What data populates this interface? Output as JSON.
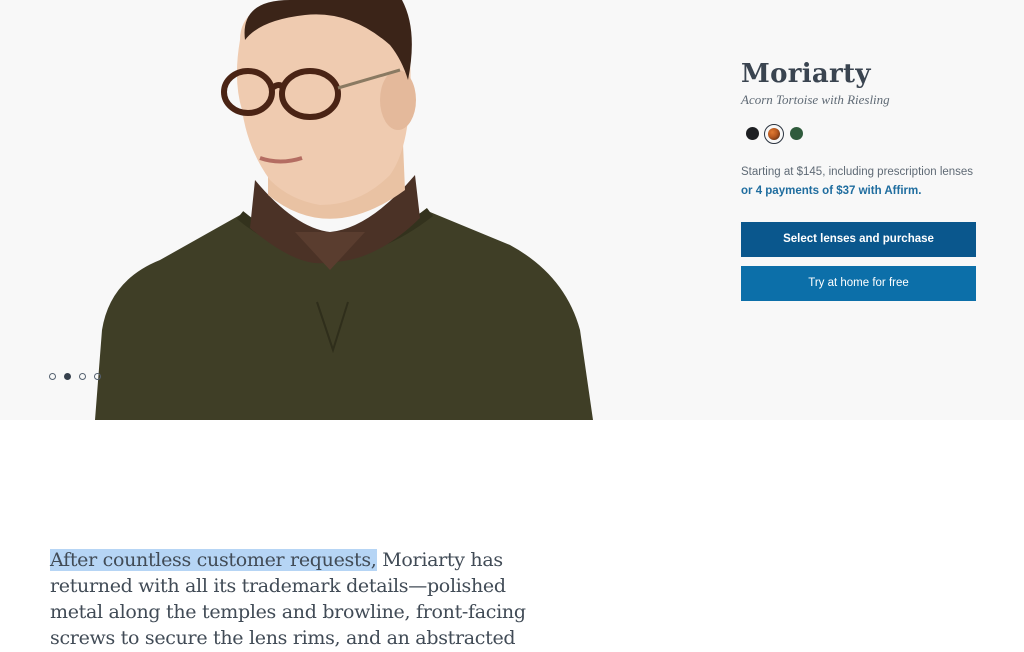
{
  "product": {
    "name": "Moriarty",
    "variant": "Acorn Tortoise with Riesling",
    "swatches": [
      {
        "name": "black",
        "color": "#1d1f22",
        "selected": false
      },
      {
        "name": "acorn-tortoise",
        "color": "#b7581f",
        "selected": true
      },
      {
        "name": "green",
        "color": "#2f5b3c",
        "selected": false
      }
    ],
    "price_line": "Starting at $145, including prescription lenses",
    "affirm_link": "or 4 payments of $37 with Affirm.",
    "primary_button": "Select lenses and purchase",
    "secondary_button": "Try at home for free"
  },
  "carousel": {
    "count": 4,
    "active_index": 1
  },
  "description": {
    "highlighted": "After countless customer requests,",
    "rest": " Moriarty has returned with all its trademark details—polished metal along the temples and browline, front-facing screws to secure the lens rims, and an abstracted keyhole bridge"
  },
  "colors": {
    "primary_button": "#0a578d",
    "secondary_button": "#0c6fa9",
    "affirm_link": "#1f6d9f",
    "selection_highlight": "#b6d5f5",
    "hero_background": "#f8f8f8"
  }
}
